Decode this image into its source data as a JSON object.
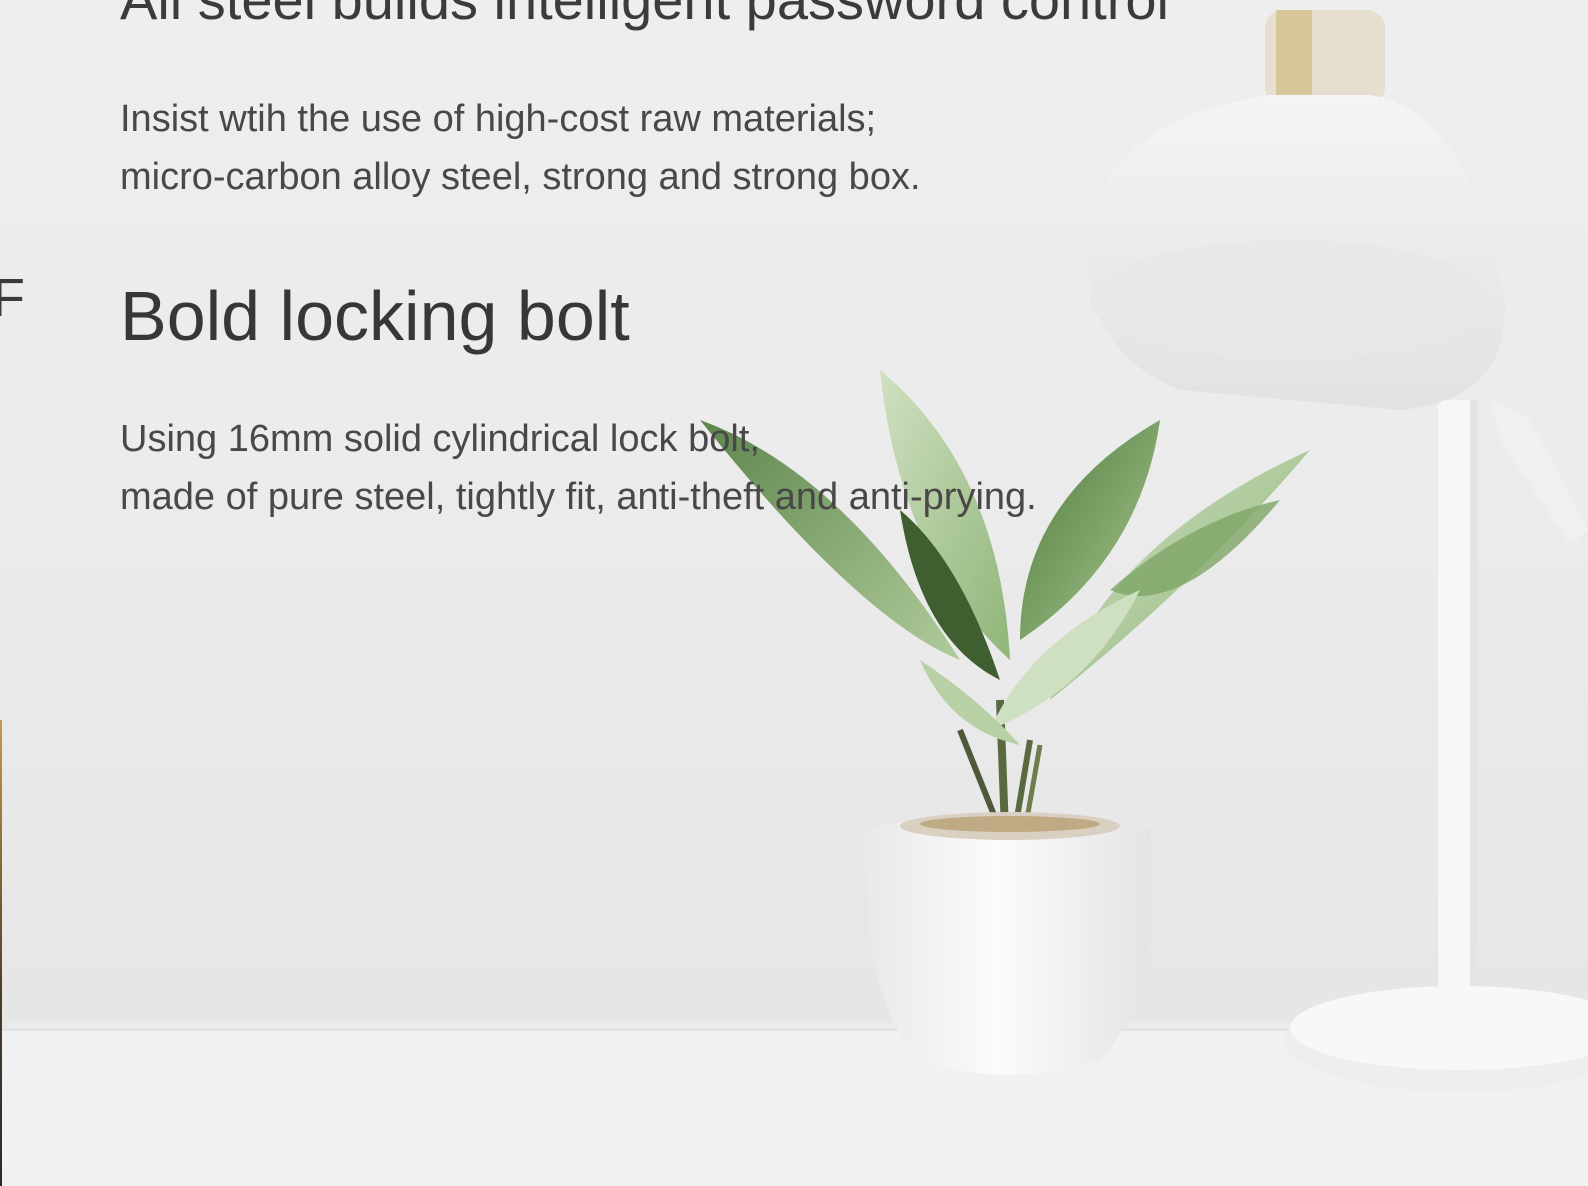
{
  "headline": "All steel builds intelligent password control",
  "materials": {
    "lines": [
      "Insist wtih the use of high-cost raw materials;",
      "micro-carbon alloy steel, strong and strong box."
    ]
  },
  "bolt_section": {
    "title": "Bold locking bolt",
    "lines": [
      "Using 16mm solid cylindrical lock bolt,",
      "made of pure steel, tightly fit, anti-theft and anti-prying."
    ]
  },
  "edge_fragment": "F",
  "colors": {
    "text": "#3d3a3b",
    "wall": "#ebebeb",
    "desk": "#f2f2f2",
    "leaf": "#6f9a55"
  },
  "icons": [
    "desk-lamp",
    "potted-plant"
  ]
}
